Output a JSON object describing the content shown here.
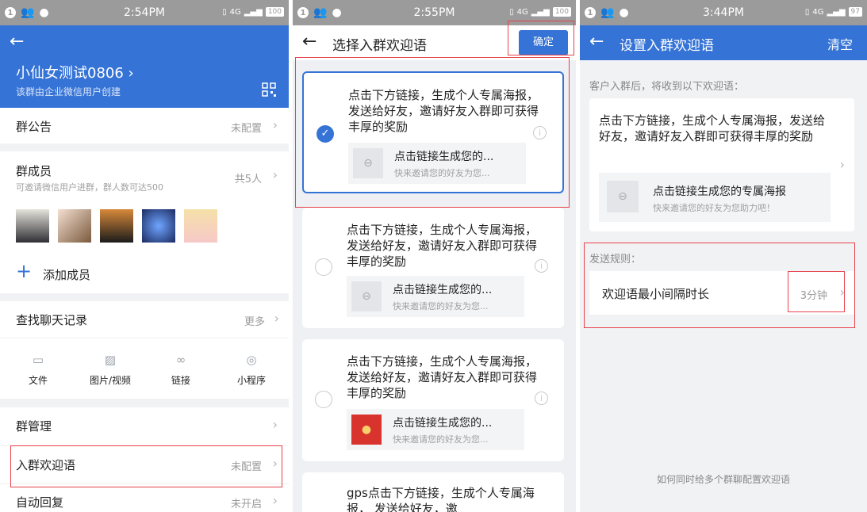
{
  "screen1": {
    "status": {
      "badge": "1",
      "time": "2:54PM",
      "signal": "4G",
      "battery": "100"
    },
    "group_name": "小仙女测试0806 ›",
    "group_sub": "该群由企业微信用户创建",
    "qr_icon": "qr-code-icon",
    "announcement": {
      "label": "群公告",
      "value": "未配置"
    },
    "members": {
      "label": "群成员",
      "sub": "可邀请微信用户进群，群人数可达500",
      "value": "共5人"
    },
    "add_member": "添加成员",
    "chat_history": {
      "label": "查找聊天记录",
      "more": "更多"
    },
    "shortcuts": [
      {
        "icon": "folder-icon",
        "label": "文件"
      },
      {
        "icon": "image-icon",
        "label": "图片/视频"
      },
      {
        "icon": "link-icon",
        "label": "链接"
      },
      {
        "icon": "mini-program-icon",
        "label": "小程序"
      }
    ],
    "group_manage": "群管理",
    "welcome": {
      "label": "入群欢迎语",
      "value": "未配置"
    },
    "auto_reply": {
      "label": "自动回复",
      "value": "未开启"
    }
  },
  "screen2": {
    "status": {
      "badge": "1",
      "time": "2:55PM",
      "signal": "4G",
      "battery": "100"
    },
    "title": "选择入群欢迎语",
    "confirm": "确定",
    "messages": [
      {
        "text": "点击下方链接，生成个人专属海报， 发送给好友，邀请好友入群即可获得丰厚的奖励",
        "link_title": "点击链接生成您的...",
        "link_sub": "快来邀请您的好友为您...",
        "selected": true,
        "thumb": "link"
      },
      {
        "text": "点击下方链接，生成个人专属海报， 发送给好友，邀请好友入群即可获得丰厚的奖励",
        "link_title": "点击链接生成您的...",
        "link_sub": "快来邀请您的好友为您...",
        "selected": false,
        "thumb": "link"
      },
      {
        "text": "点击下方链接，生成个人专属海报， 发送给好友，邀请好友入群即可获得丰厚的奖励",
        "link_title": "点击链接生成您的...",
        "link_sub": "快来邀请您的好友为您...",
        "selected": false,
        "thumb": "red-packet"
      },
      {
        "text": "gps点击下方链接，生成个人专属海报， 发送给好友，邀"
      }
    ]
  },
  "screen3": {
    "status": {
      "badge": "1",
      "time": "3:44PM",
      "signal": "4G",
      "battery": "97"
    },
    "title": "设置入群欢迎语",
    "clear": "清空",
    "intro": "客户入群后，将收到以下欢迎语：",
    "message": "点击下方链接，生成个人专属海报，发送给好友，邀请好友入群即可获得丰厚的奖励",
    "link_title": "点击链接生成您的专属海报",
    "link_sub": "快来邀请您的好友为您助力吧！",
    "rules_label": "发送规则：",
    "interval_label": "欢迎语最小间隔时长",
    "interval_value": "3分钟",
    "footer_link": "如何同时给多个群聊配置欢迎语"
  },
  "colors": {
    "accent": "#3573d6",
    "highlight": "#e8414b",
    "statusbar": "#9b9b9b"
  }
}
